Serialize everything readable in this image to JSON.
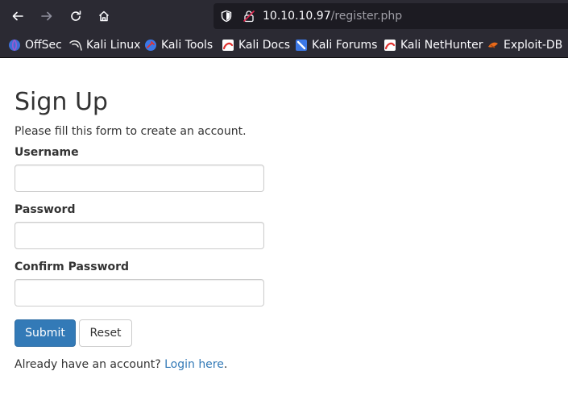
{
  "browser": {
    "url_host": "10.10.10.97",
    "url_path": "/register.php",
    "bookmarks": [
      {
        "label": "OffSec",
        "icon": "offsec-icon",
        "color": "#3d6fd6"
      },
      {
        "label": "Kali Linux",
        "icon": "kali-dragon-icon",
        "color": "#e8e8e8"
      },
      {
        "label": "Kali Tools",
        "icon": "kali-tools-icon",
        "color": "#3c78e6"
      },
      {
        "label": "Kali Docs",
        "icon": "kali-docs-icon",
        "color": "#e0322f"
      },
      {
        "label": "Kali Forums",
        "icon": "kali-forums-icon",
        "color": "#3c78e6"
      },
      {
        "label": "Kali NetHunter",
        "icon": "kali-nethunter-icon",
        "color": "#e0322f"
      },
      {
        "label": "Exploit-DB",
        "icon": "exploit-db-icon",
        "color": "#e86a1a"
      }
    ]
  },
  "form": {
    "title": "Sign Up",
    "subtitle": "Please fill this form to create an account.",
    "username_label": "Username",
    "username_value": "",
    "password_label": "Password",
    "password_value": "",
    "confirm_label": "Confirm Password",
    "confirm_value": "",
    "submit_label": "Submit",
    "reset_label": "Reset",
    "login_prompt": "Already have an account?",
    "login_link": "Login here",
    "login_suffix": "."
  },
  "colors": {
    "primary": "#337ab7",
    "chrome": "#2b2a33",
    "text": "#333333"
  }
}
